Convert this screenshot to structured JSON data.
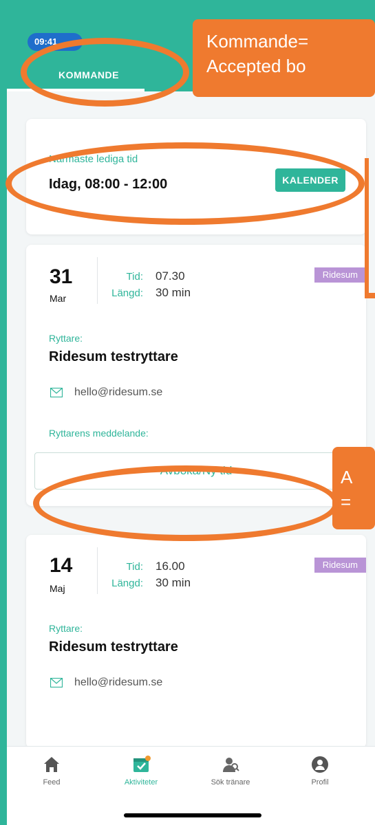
{
  "status": {
    "time": "09:41"
  },
  "tabs": {
    "upcoming_label": "KOMMANDE"
  },
  "next_available": {
    "label": "Närmaste lediga tid",
    "value": "Idag, 08:00 - 12:00",
    "calendar_button": "KALENDER"
  },
  "bookings": [
    {
      "day": "31",
      "month": "Mar",
      "time_label": "Tid:",
      "time_value": "07.30",
      "length_label": "Längd:",
      "length_value": "30 min",
      "badge": "Ridesum",
      "rider_label": "Ryttare:",
      "rider_name": "Ridesum testryttare",
      "email": "hello@ridesum.se",
      "message_label": "Ryttarens meddelande:",
      "action_label": "Avboka/Ny tid"
    },
    {
      "day": "14",
      "month": "Maj",
      "time_label": "Tid:",
      "time_value": "16.00",
      "length_label": "Längd:",
      "length_value": "30 min",
      "badge": "Ridesum",
      "rider_label": "Ryttare:",
      "rider_name": "Ridesum testryttare",
      "email": "hello@ridesum.se"
    }
  ],
  "bottom_nav": {
    "feed": "Feed",
    "activities": "Aktiviteter",
    "search_trainer": "Sök tränare",
    "profile": "Profil"
  },
  "annotations": {
    "callout_top_line1": "Kommande=",
    "callout_top_line2": "Accepted bo",
    "callout_mid_line1": "A",
    "callout_mid_line2": "="
  },
  "colors": {
    "accent": "#2fb59a",
    "badge": "#b994d6",
    "annotation": "#ef7a2f"
  }
}
